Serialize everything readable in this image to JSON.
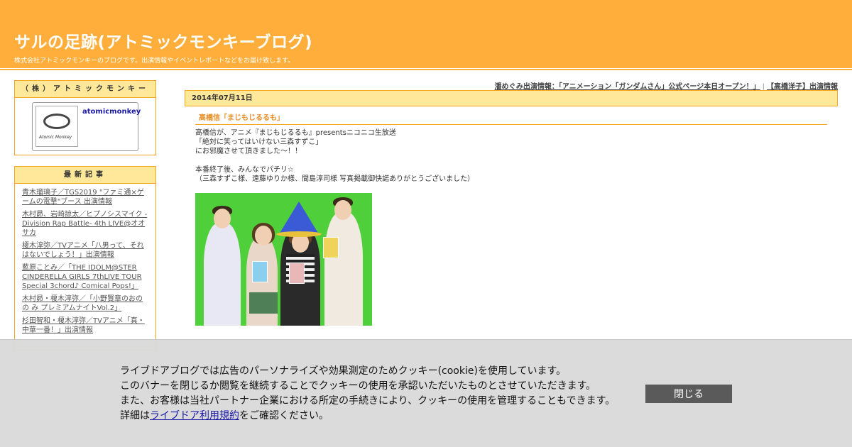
{
  "header": {
    "title": "サルの足跡(アトミックモンキーブログ)",
    "description": "株式会社アトミックモンキーのブログです。出演情報やイベントレポートなどをお届け致します。"
  },
  "sidebar": {
    "profile": {
      "heading": "（株）アトミックモンキー",
      "name": "atomicmonkey",
      "logo_text": "Atomic Monkey"
    },
    "recent": {
      "heading": "最新記事",
      "items": [
        "青木瑠璃子／TGS2019 \"ファミ通×ゲームの電撃\"ブース 出演情報",
        "木村昴、岩崎諒太／ヒプノシスマイク -Division Rap Battle- 4th LIVE@オオサカ",
        "榎木淳弥／TVアニメ「八男って、それはないでしょう！」出演情報",
        "藍原ことみ／「THE IDOLM@STER CINDERELLA GIRLS 7thLIVE TOUR Special 3chord♪ Comical Pops!」",
        "木村昴・榎木淳弥／「小野賢章のおのの み プレミアムナイトVol.2」",
        "杉田智和・榎木淳弥／TVアニメ「真・中華一番！」出演情報"
      ]
    }
  },
  "topnav": {
    "prev": "潘めぐみ出演情報：「アニメーション「ガンダムさん」公式ページ本日オープン！」",
    "separator": "|",
    "next": "【高橋洋子】出演情報"
  },
  "post": {
    "date": "2014年07月11日",
    "title": "高橋信「まじもじるるも」",
    "lines": [
      "高橋信が、アニメ『まじもじるるも』presentsニコニコ生放送",
      "「絶対に笑ってはいけない三森すずこ」",
      "にお邪魔させて頂きました～！！",
      "",
      "本番終了後、みんなでパチリ☆",
      "（三森すずこ様、遠藤ゆりか様、間島淳司様 写真掲載御快諾ありがとうございました）"
    ]
  },
  "cookie_banner": {
    "line1": "ライブドアブログでは広告のパーソナライズや効果測定のためクッキー(cookie)を使用しています。",
    "line2": "このバナーを閉じるか閲覧を継続することでクッキーの使用を承認いただいたものとさせていただきます。",
    "line3": "また、お客様は当社パートナー企業における所定の手続きにより、クッキーの使用を管理することもできます。",
    "line4_prefix": "詳細は",
    "line4_link": "ライブドア利用規約",
    "line4_suffix": "をご確認ください。",
    "close_label": "閉じる"
  },
  "colors": {
    "header_bg": "#ffae3b",
    "box_head_bg": "#ffe89a",
    "border": "#f5a623",
    "title_accent": "#e8902a"
  }
}
